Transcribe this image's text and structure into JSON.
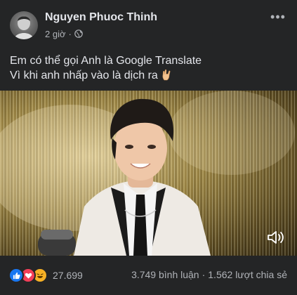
{
  "post": {
    "author": "Nguyen Phuoc Thinh",
    "time": "2 giờ",
    "separator": "·",
    "privacy_icon": "globe-icon",
    "more_icon": "ellipsis-icon",
    "more_label": "•••",
    "caption_line1": "Em có thể gọi Anh là Google Translate",
    "caption_line2": "Vì khi anh nhấp vào là dịch ra",
    "caption_emoji": "love-you-gesture-emoji"
  },
  "video": {
    "mute_icon": "speaker-muted-icon"
  },
  "footer": {
    "reaction_icons": [
      "like-reaction-icon",
      "love-reaction-icon",
      "haha-reaction-icon"
    ],
    "reaction_count": "27.699",
    "comments": "3.749 bình luận",
    "dot": "·",
    "shares": "1.562 lượt chia sẻ"
  },
  "colors": {
    "background": "#242526",
    "text_primary": "#e4e6eb",
    "text_secondary": "#b0b3b8",
    "like": "#1877f2",
    "love": "#f33e58",
    "haha": "#f7b125"
  }
}
